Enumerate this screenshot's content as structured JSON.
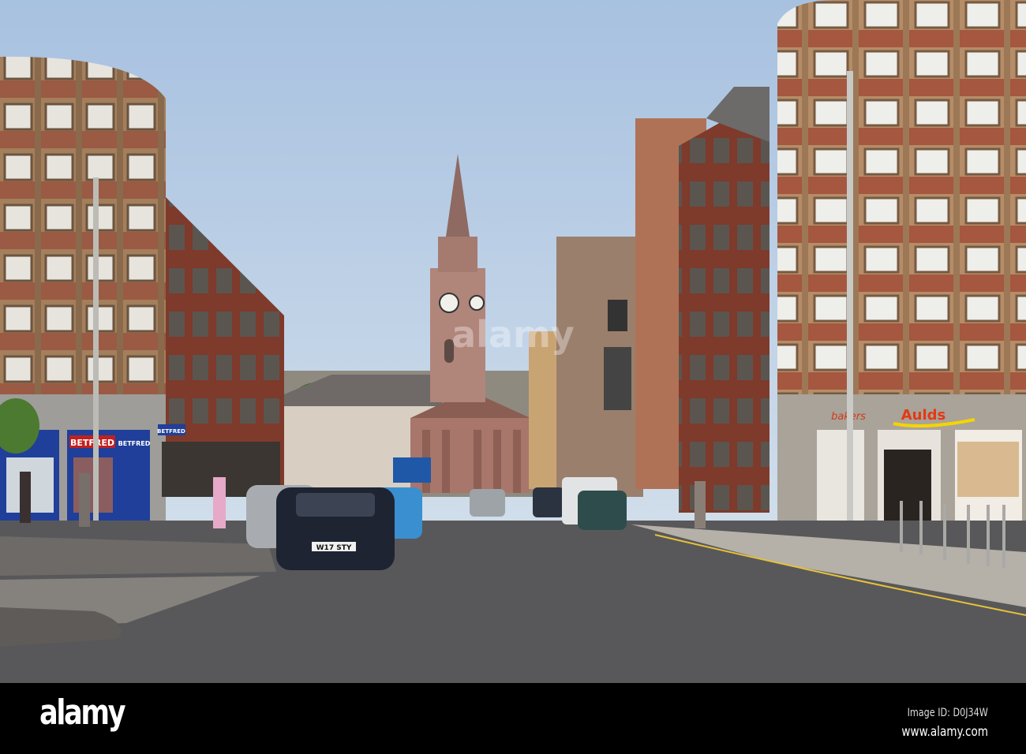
{
  "photo": {
    "signs": {
      "betfred_1": "BETFRED",
      "betfred_2": "BETFRED",
      "betfred_3": "BETFRED",
      "aulds": "Aulds",
      "bakers": "bakers",
      "number_plate": "W17 STY"
    },
    "watermark": "alamy"
  },
  "footer": {
    "logo": "alamy",
    "image_id": "Image ID: D0J34W",
    "url": "www.alamy.com"
  }
}
